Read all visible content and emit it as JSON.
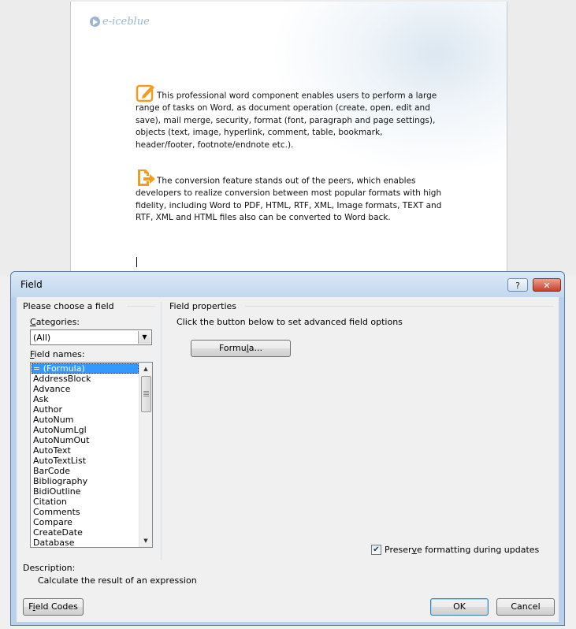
{
  "document": {
    "logo_text": "e-iceblue",
    "paragraph1": "This professional word component enables users to perform a large range of tasks on Word, as document operation (create, open, edit and save), mail merge, security, format (font, paragraph and page settings), objects (text, image, hyperlink, comment, table, bookmark, header/footer, footnote/endnote etc.).",
    "paragraph2": "The conversion feature stands out of the peers, which enables developers to realize conversion between most popular formats with high fidelity, including Word to PDF, HTML, RTF, XML, Image formats, TEXT and RTF, XML and HTML files also can be converted to Word back.",
    "icon1": "edit-icon",
    "icon2": "export-icon",
    "icon_color": "#f39c1f"
  },
  "dialog": {
    "title": "Field",
    "help_label": "?",
    "close_label": "✕",
    "left_group_title": "Please choose a field",
    "categories_label_u": "C",
    "categories_label_rest": "ategories:",
    "categories_value": "(All)",
    "field_names_label_u": "F",
    "field_names_label_rest": "ield names:",
    "field_names": [
      "= (Formula)",
      "AddressBlock",
      "Advance",
      "Ask",
      "Author",
      "AutoNum",
      "AutoNumLgl",
      "AutoNumOut",
      "AutoText",
      "AutoTextList",
      "BarCode",
      "Bibliography",
      "BidiOutline",
      "Citation",
      "Comments",
      "Compare",
      "CreateDate",
      "Database"
    ],
    "selected_field": "= (Formula)",
    "right_group_title": "Field properties",
    "instruction": "Click the button below to set advanced field options",
    "formula_button_pre": "Formu",
    "formula_button_u": "l",
    "formula_button_post": "a...",
    "preserve_pre": "Preser",
    "preserve_u": "v",
    "preserve_post": "e formatting during updates",
    "preserve_checked": true,
    "description_label": "Description:",
    "description_text": "Calculate the result of an expression",
    "field_codes_pre": "F",
    "field_codes_u": "i",
    "field_codes_post": "eld Codes",
    "ok_label": "OK",
    "cancel_label": "Cancel",
    "accent_color": "#3399ff"
  }
}
